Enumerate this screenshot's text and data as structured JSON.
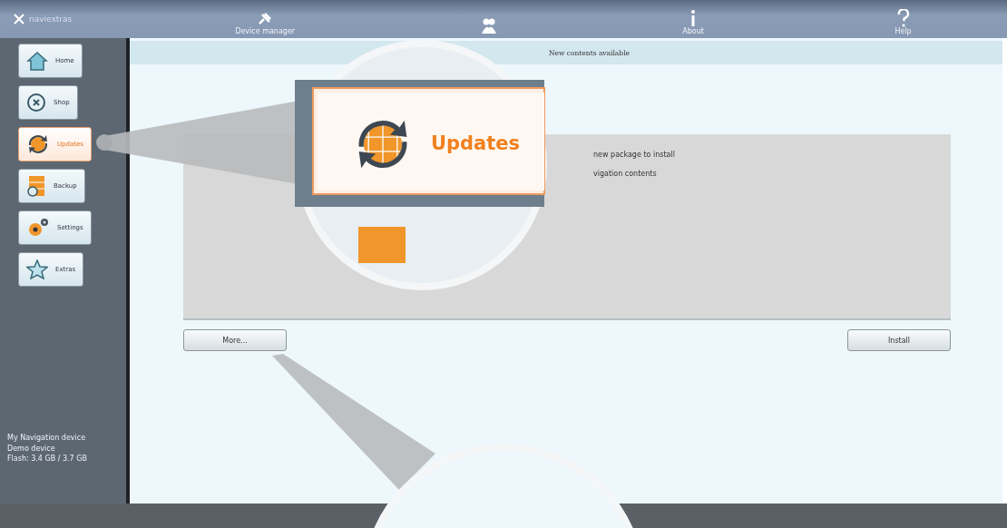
{
  "toolbar": {
    "logo": "naviextras",
    "items": [
      {
        "label": "Device manager"
      },
      {
        "label": "About"
      },
      {
        "label": "Help"
      }
    ]
  },
  "sidebar": {
    "items": [
      {
        "label": "Home",
        "selected": false
      },
      {
        "label": "Shop",
        "selected": false
      },
      {
        "label": "Updates",
        "selected": true
      },
      {
        "label": "Backup",
        "selected": false
      },
      {
        "label": "Settings",
        "selected": false
      },
      {
        "label": "Extras",
        "selected": false
      }
    ],
    "device_info": [
      "My Navigation device",
      "Demo device",
      "Flash: 3.4 GB / 3.7 GB"
    ]
  },
  "content": {
    "header": "New contents available",
    "lines": [
      "new package to install",
      "vigation contents"
    ],
    "buttons": [
      "More...",
      "Install"
    ]
  },
  "magnifier": {
    "label": "Updates"
  }
}
